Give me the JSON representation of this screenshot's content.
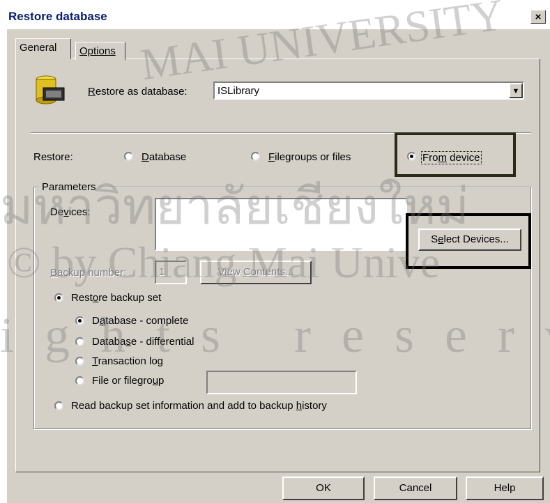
{
  "window": {
    "title": "Restore database",
    "close_glyph": "×"
  },
  "tabs": [
    {
      "label": "General",
      "active": true
    },
    {
      "label": "Options",
      "active": false
    }
  ],
  "restore_as": {
    "label_pre": "",
    "label_u": "R",
    "label_post": "estore as database:",
    "value": "ISLibrary"
  },
  "restore": {
    "label": "Restore:",
    "options": [
      {
        "u": "D",
        "post": "atabase",
        "pre": "",
        "selected": false
      },
      {
        "u": "F",
        "post": "ilegroups or files",
        "pre": "",
        "selected": false
      },
      {
        "pre": "Fro",
        "u": "m",
        "post": " device",
        "selected": true
      }
    ]
  },
  "parameters": {
    "legend": "Parameters",
    "devices": {
      "pre": "De",
      "u": "v",
      "post": "ices:"
    },
    "select_devices": {
      "pre": "S",
      "u": "e",
      "post": "lect Devices..."
    },
    "backup_number": {
      "pre": "",
      "u": "B",
      "post": "ackup number:",
      "value": "1"
    },
    "view_contents": {
      "pre": "View ",
      "u": "C",
      "post": "ontents..."
    },
    "restore_backup_set": {
      "pre": "Rest",
      "u": "o",
      "post": "re backup set",
      "selected": true
    },
    "sub_options": [
      {
        "pre": "D",
        "u": "a",
        "post": "tabase - complete",
        "selected": true
      },
      {
        "pre": "Databa",
        "u": "s",
        "post": "e - differential",
        "selected": false
      },
      {
        "pre": "",
        "u": "T",
        "post": "ransaction log",
        "selected": false
      },
      {
        "pre": "File or filegro",
        "u": "u",
        "post": "p",
        "selected": false
      }
    ],
    "read_history": {
      "pre": "Read backup set information and add to backup ",
      "u": "h",
      "post": "istory",
      "selected": false
    }
  },
  "footer": {
    "ok": "OK",
    "cancel": "Cancel",
    "help": "Help"
  },
  "watermark": [
    "MAI UNIVERSITY",
    "มหาวิทยาลัยเชียงใหม่",
    "© by Chiang Mai Unive",
    "ights reserv"
  ],
  "colors": {
    "dialog": "#d4d0c8",
    "title": "#0a2070",
    "highlight_box": "#2a2a1a"
  }
}
